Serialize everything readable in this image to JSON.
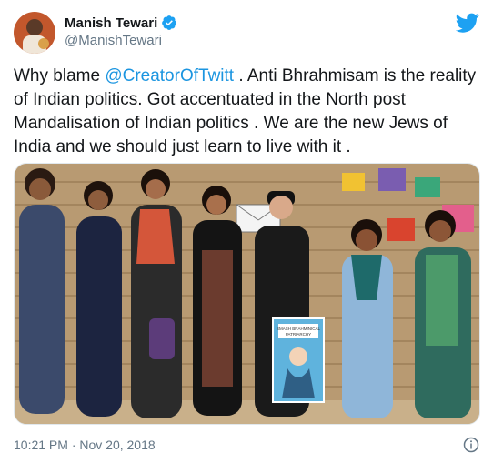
{
  "author": {
    "display_name": "Manish Tewari",
    "handle": "@ManishTewari",
    "verified": true
  },
  "tweet": {
    "text_before": "Why blame ",
    "mention": "@CreatorOfTwitt",
    "text_after": " . Anti Bhrahmisam is the reality of Indian politics. Got accentuated in the North post Mandalisation of Indian politics . We are the new Jews of India and we should just learn to live with it ."
  },
  "photo": {
    "poster_line1": "SMASH BRAHMINICAL",
    "poster_line2": "PATRIARCHY"
  },
  "footer": {
    "timestamp": "10:21 PM · Nov 20, 2018"
  },
  "colors": {
    "link": "#1b95e0",
    "twitter_blue": "#1da1f2",
    "muted": "#657786",
    "text": "#14171a"
  },
  "icons": [
    "verified-badge-icon",
    "twitter-bird-icon",
    "info-icon"
  ]
}
